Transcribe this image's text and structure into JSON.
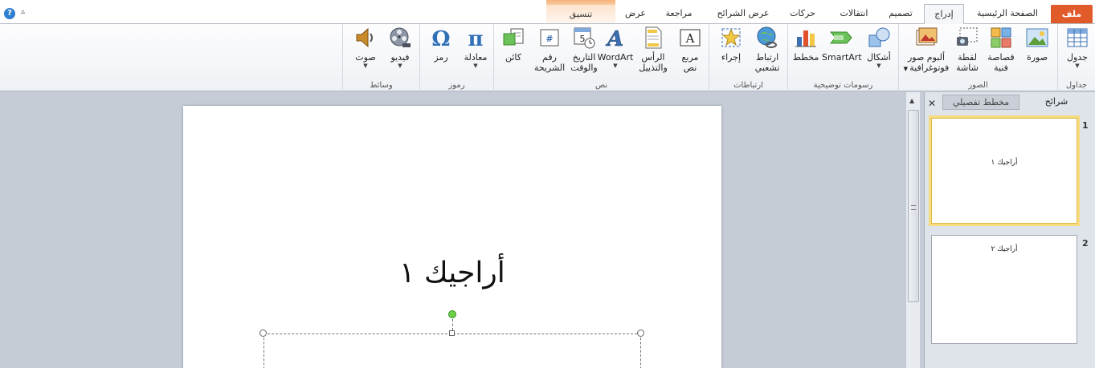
{
  "tabs": {
    "file": "ملف",
    "home": "الصفحة الرئيسية",
    "insert": "إدراج",
    "design": "تصميم",
    "transitions": "انتقالات",
    "animations": "حركات",
    "slideshow": "عرض الشرائح",
    "review": "مراجعة",
    "view": "عرض",
    "format": "تنسيق"
  },
  "ribbon": {
    "tables": {
      "label": "جداول",
      "table": "جدول"
    },
    "images": {
      "label": "الصور",
      "picture": "صورة",
      "clipart_1": "قصاصة",
      "clipart_2": "فنية",
      "screenshot_1": "لقطة",
      "screenshot_2": "شاشة",
      "album_1": "ألبوم صور",
      "album_2": "فوتوغرافية"
    },
    "illustrations": {
      "label": "رسومات توضيحية",
      "shapes": "أشكال",
      "smartart": "SmartArt",
      "chart": "مخطط"
    },
    "links": {
      "label": "ارتباطات",
      "hyperlink_1": "ارتباط",
      "hyperlink_2": "تشعبي",
      "action": "إجراء"
    },
    "text": {
      "label": "نص",
      "textbox_1": "مربع",
      "textbox_2": "نص",
      "headerfooter_1": "الرأس",
      "headerfooter_2": "والتذييل",
      "wordart": "WordArt",
      "datetime_1": "التاريخ",
      "datetime_2": "والوقت",
      "slidenum_1": "رقم",
      "slidenum_2": "الشريحة",
      "object": "كائن"
    },
    "symbols": {
      "label": "رموز",
      "equation": "معادلة",
      "symbol": "رمز"
    },
    "media": {
      "label": "وسائط",
      "video": "فيديو",
      "audio": "صوت"
    }
  },
  "pane": {
    "tab_slides": "شرائح",
    "tab_outline": "مخطط تفصيلي"
  },
  "slides": [
    {
      "number": "1",
      "title": "أراجيك ١"
    },
    {
      "number": "2",
      "title": "أراجيك ٢"
    }
  ],
  "editor": {
    "title": "أراجيك ١"
  },
  "colors": {
    "file_tab": "#e05a2a",
    "selection": "#f6dc7f",
    "rotate_handle": "#6cd14a"
  }
}
